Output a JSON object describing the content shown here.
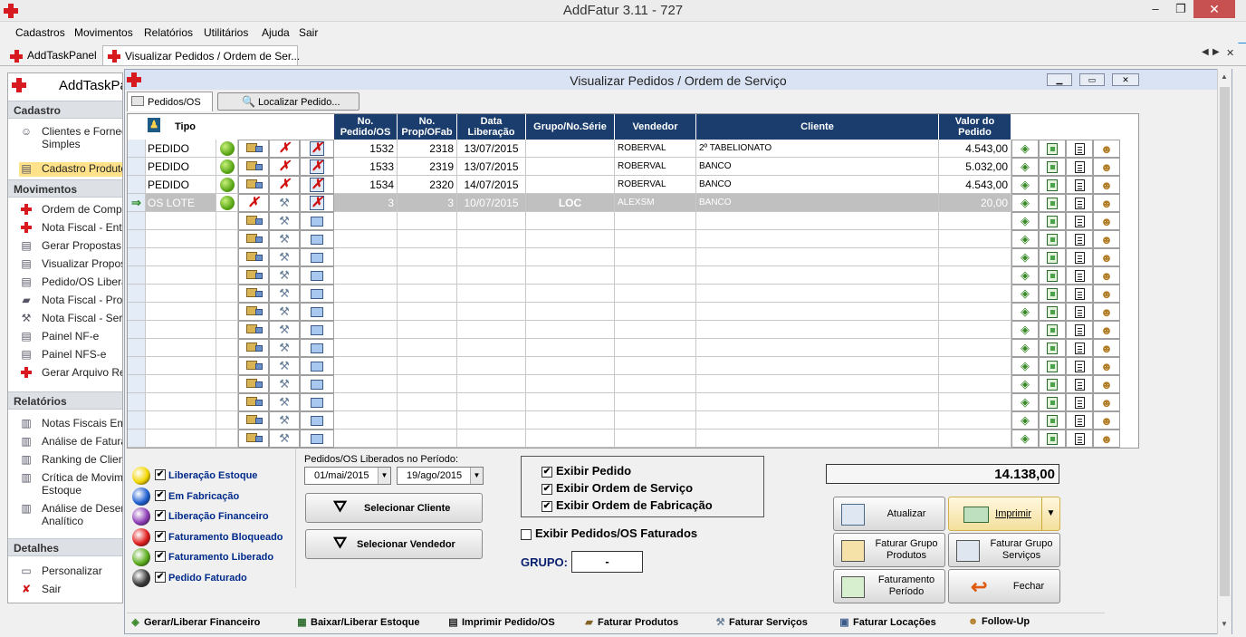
{
  "window": {
    "title": "AddFatur 3.11 - 727",
    "minimize": "–",
    "maximize": "❐",
    "close": "✕"
  },
  "menu": [
    "Cadastros",
    "Movimentos",
    "Relatórios",
    "Utilitários",
    "Ajuda",
    "Sair"
  ],
  "tabs": [
    {
      "label": "AddTaskPanel"
    },
    {
      "label": "Visualizar Pedidos / Ordem de Ser..."
    }
  ],
  "tab_scroll": {
    "left": "◀",
    "right": "▶",
    "close": "✕"
  },
  "taskpanel": {
    "title": "AddTaskPa",
    "sections": [
      {
        "title": "Cadastro",
        "items": [
          {
            "label": "Clientes e Fornec",
            "label2": "Simples",
            "icon": "people-icon"
          },
          {
            "label": "Cadastro Produto",
            "icon": "folder-icon"
          }
        ]
      },
      {
        "title": "Movimentos",
        "items": [
          {
            "label": "Ordem de Comp",
            "icon": "redcross-icon"
          },
          {
            "label": "Nota Fiscal  - Ent",
            "icon": "redcross-icon"
          },
          {
            "label": "Gerar Propostas",
            "icon": "doc-icon"
          },
          {
            "label": "Visualizar Propos",
            "icon": "doc-icon"
          },
          {
            "label": "Pedido/OS Libera",
            "icon": "doc-icon"
          },
          {
            "label": "Nota Fiscal  - Pro",
            "icon": "truck-icon"
          },
          {
            "label": "Nota Fiscal  - Serv",
            "icon": "wrench-icon"
          },
          {
            "label": "Painel NF-e",
            "icon": "doc-icon"
          },
          {
            "label": "Painel NFS-e",
            "icon": "doc-icon"
          },
          {
            "label": "Gerar Arquivo Re",
            "icon": "redcross-icon"
          }
        ]
      },
      {
        "title": "Relatórios",
        "items": [
          {
            "label": "Notas Fiscais Em",
            "icon": "chart-icon"
          },
          {
            "label": "Análise de Fatura",
            "icon": "chart-icon"
          },
          {
            "label": "Ranking de Clien",
            "icon": "chart-icon"
          },
          {
            "label": "Crítica de Movim",
            "label2": "Estoque",
            "icon": "chart-icon"
          },
          {
            "label": "Análise de Desem",
            "label2": "Analítico",
            "icon": "chart-icon"
          }
        ]
      },
      {
        "title": "Detalhes",
        "items": [
          {
            "label": "Personalizar",
            "icon": "settings-icon"
          },
          {
            "label": "Sair",
            "icon": "exit-icon"
          }
        ]
      }
    ]
  },
  "mdi": {
    "title": "Visualizar Pedidos / Ordem de Serviço"
  },
  "page_tabs": {
    "pedidos": "Pedidos/OS",
    "localizar": "Localizar Pedido..."
  },
  "grid": {
    "headers": {
      "tipo": "Tipo",
      "pedido": "No. Pedido/OS",
      "prop": "No. Prop/OFab",
      "data": "Data Liberação",
      "grupo": "Grupo/No.Série",
      "vendedor": "Vendedor",
      "cliente": "Cliente",
      "valor": "Valor do Pedido"
    },
    "rows": [
      {
        "tipo": "PEDIDO",
        "pedido": "1532",
        "prop": "2318",
        "data": "13/07/2015",
        "grupo": "",
        "vendedor": "ROBERVAL",
        "cliente": "2º TABELIONATO",
        "valor": "4.543,00"
      },
      {
        "tipo": "PEDIDO",
        "pedido": "1533",
        "prop": "2319",
        "data": "13/07/2015",
        "grupo": "",
        "vendedor": "ROBERVAL",
        "cliente": "BANCO",
        "valor": "5.032,00"
      },
      {
        "tipo": "PEDIDO",
        "pedido": "1534",
        "prop": "2320",
        "data": "14/07/2015",
        "grupo": "",
        "vendedor": "ROBERVAL",
        "cliente": "BANCO",
        "valor": "4.543,00"
      },
      {
        "tipo": "OS LOTE",
        "pedido": "3",
        "prop": "3",
        "data": "10/07/2015",
        "grupo": "LOC",
        "vendedor": "ALEXSM",
        "cliente": "BANCO",
        "valor": "20,00"
      }
    ],
    "current_row_marker": "⇒",
    "empty_rows": 13
  },
  "legend": [
    {
      "label": "Liberação Estoque",
      "color": "#f2d600"
    },
    {
      "label": "Em Fabricação",
      "color": "#1f5fd1"
    },
    {
      "label": "Liberação Financeiro",
      "color": "#8c3bb5"
    },
    {
      "label": "Faturamento Bloqueado",
      "color": "#e01c1c"
    },
    {
      "label": "Faturamento Liberado",
      "color": "#5aac1b"
    },
    {
      "label": "Pedido Faturado",
      "color": "#3a3a3a"
    }
  ],
  "checkmark": "✔",
  "period": {
    "label": "Pedidos/OS Liberados no Período:",
    "from": "01/mai/2015",
    "to": "19/ago/2015",
    "arrow": "▼"
  },
  "filters": {
    "cliente": "Selecionar Cliente",
    "vendedor": "Selecionar Vendedor"
  },
  "options": {
    "exibir_pedido": "Exibir Pedido",
    "exibir_os": "Exibir Ordem de Serviço",
    "exibir_of": "Exibir Ordem de Fabricação",
    "exibir_faturados": "Exibir Pedidos/OS Faturados"
  },
  "grupo": {
    "label": "GRUPO:",
    "value": "-"
  },
  "total": "14.138,00",
  "actions": {
    "atualizar": "Atualizar",
    "imprimir": "Imprimir",
    "faturar_produtos": "Faturar Grupo Produtos",
    "faturar_servicos": "Faturar Grupo Serviços",
    "faturamento_periodo": "Faturamento Período",
    "fechar": "Fechar"
  },
  "footer": [
    "Gerar/Liberar Financeiro",
    "Baixar/Liberar Estoque",
    "Imprimir Pedido/OS",
    "Faturar Produtos",
    "Faturar Serviços",
    "Faturar Locações",
    "Follow-Up"
  ],
  "colors": {
    "header_bg": "#1a3d6e",
    "selected_row": "#c0c0c0",
    "accent_red": "#d71920"
  }
}
